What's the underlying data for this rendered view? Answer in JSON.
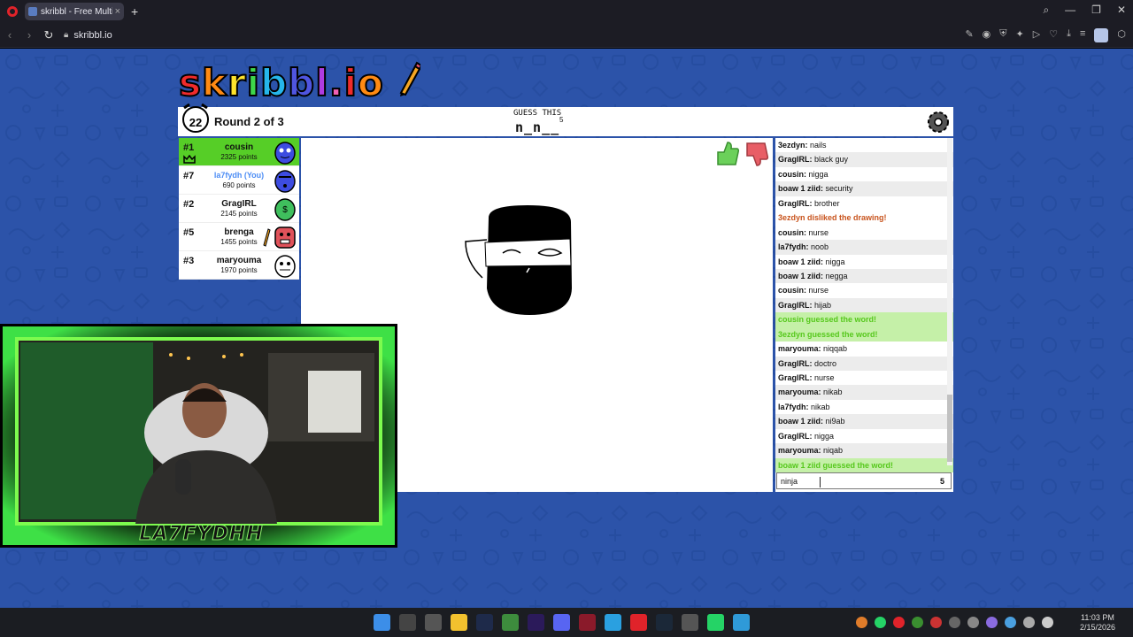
{
  "browser": {
    "tab_title": "skribbl - Free Multiple",
    "tab_close": "×",
    "new_tab": "+",
    "url": "skribbl.io",
    "win_minimize": "—",
    "win_restore": "❐",
    "win_close": "✕"
  },
  "game": {
    "logo": "skribbl.io",
    "timer": "22",
    "round": "Round 2 of 3",
    "guess_label": "GUESS THIS",
    "word_hint": "n_n__",
    "word_length": "5",
    "accent_green": "#56ce27",
    "bg_blue": "#2c53a9"
  },
  "players": [
    {
      "rank": "#1",
      "name": "cousin",
      "points": "2325 points",
      "color": "#3d4ce0"
    },
    {
      "rank": "#7",
      "name": "la7fydh (You)",
      "points": "690 points",
      "color": "#3d4ce0"
    },
    {
      "rank": "#2",
      "name": "GragIRL",
      "points": "2145 points",
      "color": "#3fbf5d"
    },
    {
      "rank": "#5",
      "name": "brenga",
      "points": "1455 points",
      "color": "#e0525a"
    },
    {
      "rank": "#3",
      "name": "maryouma",
      "points": "1970 points",
      "color": "#ffffff"
    }
  ],
  "chat": [
    {
      "user": "3ezdyn:",
      "text": "nails",
      "kind": "normal"
    },
    {
      "user": "GragIRL:",
      "text": "black guy",
      "kind": "normal"
    },
    {
      "user": "cousin:",
      "text": "nigga",
      "kind": "normal"
    },
    {
      "user": "boaw 1 ziid:",
      "text": "security",
      "kind": "normal"
    },
    {
      "user": "GragIRL:",
      "text": "brother",
      "kind": "normal"
    },
    {
      "user": "",
      "text": "3ezdyn disliked the drawing!",
      "kind": "orange"
    },
    {
      "user": "cousin:",
      "text": "nurse",
      "kind": "normal"
    },
    {
      "user": "la7fydh:",
      "text": "noob",
      "kind": "normal"
    },
    {
      "user": "boaw 1 ziid:",
      "text": "nigga",
      "kind": "normal"
    },
    {
      "user": "boaw 1 ziid:",
      "text": "negga",
      "kind": "normal"
    },
    {
      "user": "cousin:",
      "text": "nurse",
      "kind": "normal"
    },
    {
      "user": "GragIRL:",
      "text": "hijab",
      "kind": "normal"
    },
    {
      "user": "",
      "text": "cousin guessed the word!",
      "kind": "green"
    },
    {
      "user": "",
      "text": "3ezdyn guessed the word!",
      "kind": "green"
    },
    {
      "user": "maryouma:",
      "text": "niqqab",
      "kind": "normal"
    },
    {
      "user": "GragIRL:",
      "text": "doctro",
      "kind": "normal"
    },
    {
      "user": "GragIRL:",
      "text": "nurse",
      "kind": "normal"
    },
    {
      "user": "maryouma:",
      "text": "nikab",
      "kind": "normal"
    },
    {
      "user": "la7fydh:",
      "text": "nikab",
      "kind": "normal"
    },
    {
      "user": "boaw 1 ziid:",
      "text": "ni9ab",
      "kind": "normal"
    },
    {
      "user": "GragIRL:",
      "text": "nigga",
      "kind": "normal"
    },
    {
      "user": "maryouma:",
      "text": "niqab",
      "kind": "normal"
    },
    {
      "user": "",
      "text": "boaw 1 ziid guessed the word!",
      "kind": "green"
    }
  ],
  "chat_input": {
    "value": "ninja",
    "char_count": "5"
  },
  "webcam": {
    "name": "LA7FYDHH"
  },
  "taskbar": {
    "time": "11:03 PM",
    "date": "2/15/2026"
  }
}
